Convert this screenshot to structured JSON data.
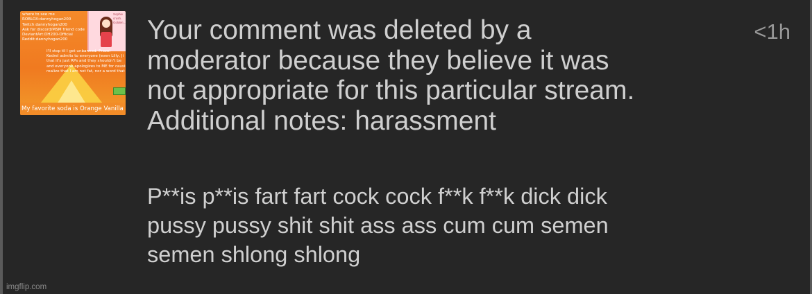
{
  "comment": {
    "timestamp": "<1h",
    "notice_text": "Your comment was deleted by a\nmoderator because they believe it was\nnot appropriate for this particular stream.\nAdditional notes: harassment",
    "body_text": "P**is p**is fart fart cock cock f**k f**k dick dick\npussy pussy shit shit ass ass cum cum semen\nsemen shlong shlong"
  },
  "avatar": {
    "lines": "where to see me\nROBLOX:dannyhogan200\nTwitch:dannyhogan200\nAsk for discord/MSM friend code\nDeviantArt:DH200-Official\nReddit:dannyhogan200",
    "card_text": "Sophie crush. Golden...",
    "message": "I'll stop til I get unbanned. Prozel\nKedrel admits to everyone (even Lilly, Ji\nthat it's just RPs and they shouldn't be\nand everyone apologizes to ME for causing\nrealize that I am not fat, nor a word that I d",
    "footer": "My favorite soda is Orange Vanilla"
  },
  "watermark": "imgflip.com"
}
